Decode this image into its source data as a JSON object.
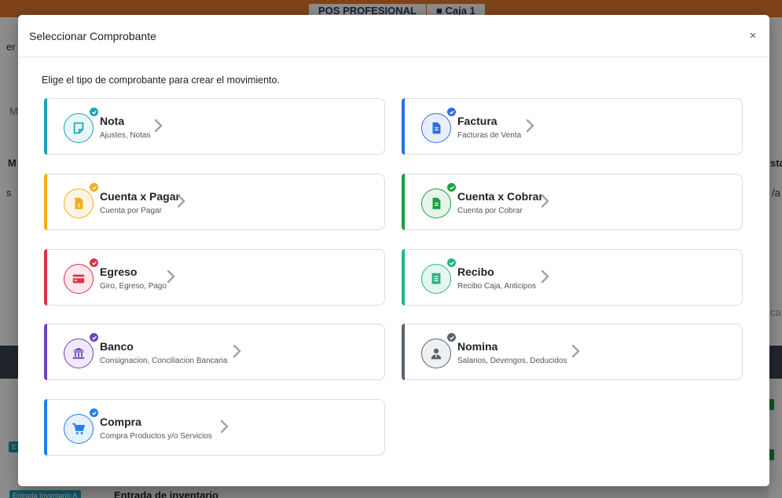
{
  "background": {
    "topbar_pill_1": "POS PROFESIONAL",
    "topbar_pill_2": "Caja 1",
    "left_fragments": [
      "er",
      "M",
      "M",
      "s"
    ],
    "right_fragments": [
      "sta",
      "/a",
      "ca"
    ],
    "badge_label": "Entrada Inventario-A",
    "badge_small": "E",
    "bottom_title": "Entrada de inventario"
  },
  "modal": {
    "title": "Seleccionar Comprobante",
    "close_label": "×",
    "intro": "Elige el tipo de comprobante para crear el movimiento."
  },
  "options": [
    {
      "title": "Nota",
      "subtitle": "Ajustes, Notas",
      "accent": "#1aa3b8",
      "icon": "note-icon"
    },
    {
      "title": "Factura",
      "subtitle": "Facturas de Venta",
      "accent": "#2f6fde",
      "icon": "invoice-icon"
    },
    {
      "title": "Cuenta x Pagar",
      "subtitle": "Cuenta por Pagar",
      "accent": "#f0ad1c",
      "icon": "payable-icon"
    },
    {
      "title": "Cuenta x Cobrar",
      "subtitle": "Cuenta por Cobrar",
      "accent": "#1e9e3f",
      "icon": "receivable-icon"
    },
    {
      "title": "Egreso",
      "subtitle": "Giro, Egreso, Pago",
      "accent": "#d9334a",
      "icon": "card-icon"
    },
    {
      "title": "Recibo",
      "subtitle": "Recibo Caja, Anticipos",
      "accent": "#22b583",
      "icon": "receipt-icon"
    },
    {
      "title": "Banco",
      "subtitle": "Consignacion, Conciliacion Bancaria",
      "accent": "#6f42c1",
      "icon": "bank-icon"
    },
    {
      "title": "Nomina",
      "subtitle": "Salarios, Devengos, Deducidos",
      "accent": "#5a6370",
      "icon": "user-icon"
    },
    {
      "title": "Compra",
      "subtitle": "Compra Productos y/o Servicios",
      "accent": "#1f7ef0",
      "icon": "cart-icon"
    }
  ]
}
